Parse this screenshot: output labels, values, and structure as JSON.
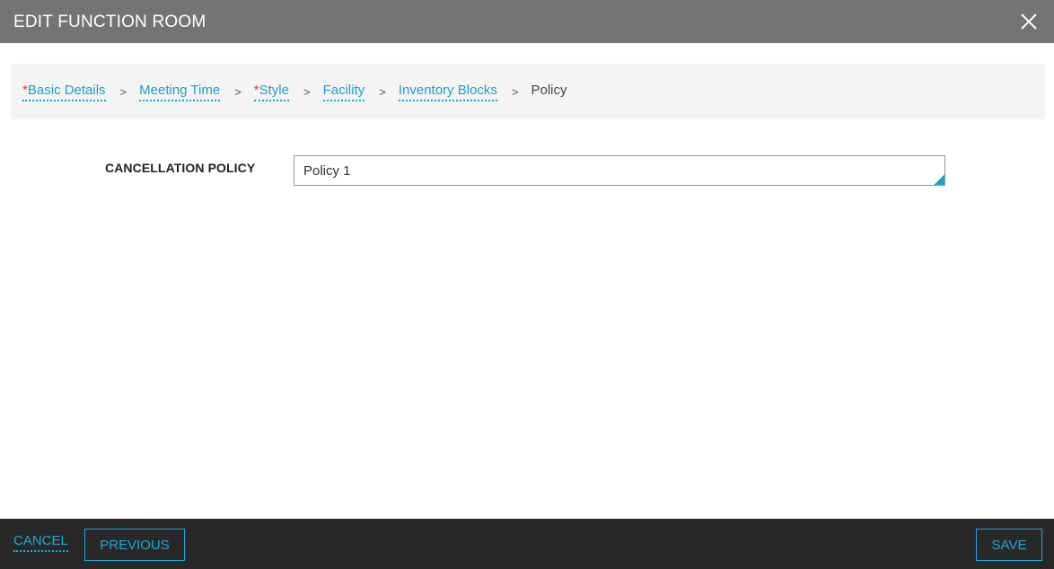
{
  "dialog": {
    "title": "EDIT FUNCTION ROOM",
    "close_icon": "close-icon"
  },
  "breadcrumb": {
    "items": [
      {
        "label": "Basic Details",
        "required": true
      },
      {
        "label": "Meeting Time",
        "required": false
      },
      {
        "label": "Style",
        "required": true
      },
      {
        "label": "Facility",
        "required": false
      },
      {
        "label": "Inventory Blocks",
        "required": false
      }
    ],
    "required_marker": "*",
    "separator": ">",
    "current": "Policy"
  },
  "form": {
    "cancellation_policy": {
      "label": "CANCELLATION POLICY",
      "value": "Policy 1"
    }
  },
  "footer": {
    "cancel_label": "CANCEL",
    "previous_label": "PREVIOUS",
    "save_label": "SAVE"
  },
  "colors": {
    "header_bg": "#747474",
    "footer_bg": "#282828",
    "accent": "#1fa9d6",
    "required": "#e53935"
  }
}
